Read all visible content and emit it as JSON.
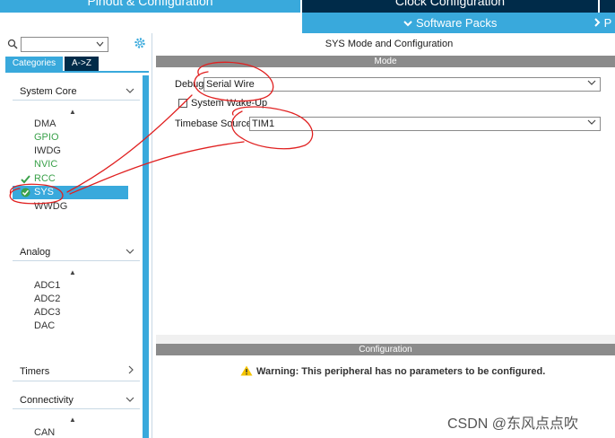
{
  "header": {
    "tabs": [
      {
        "label": "Pinout & Configuration",
        "active": true
      },
      {
        "label": "Clock Configuration",
        "active": false
      }
    ],
    "software_packs_label": "Software Packs",
    "more_label": "P"
  },
  "sidebar": {
    "search": {
      "value": "",
      "placeholder": ""
    },
    "tabs": [
      {
        "label": "Categories",
        "active": true
      },
      {
        "label": "A->Z",
        "active": false
      }
    ],
    "groups": [
      {
        "label": "System Core",
        "expanded": true,
        "items": [
          {
            "label": "DMA",
            "status": "normal"
          },
          {
            "label": "GPIO",
            "status": "configured"
          },
          {
            "label": "IWDG",
            "status": "normal"
          },
          {
            "label": "NVIC",
            "status": "configured"
          },
          {
            "label": "RCC",
            "status": "configured-checked"
          },
          {
            "label": "SYS",
            "status": "selected-checked"
          },
          {
            "label": "WWDG",
            "status": "normal"
          }
        ]
      },
      {
        "label": "Analog",
        "expanded": true,
        "items": [
          {
            "label": "ADC1",
            "status": "normal"
          },
          {
            "label": "ADC2",
            "status": "normal"
          },
          {
            "label": "ADC3",
            "status": "normal"
          },
          {
            "label": "DAC",
            "status": "normal"
          }
        ]
      },
      {
        "label": "Timers",
        "expanded": false,
        "items": []
      },
      {
        "label": "Connectivity",
        "expanded": true,
        "items": [
          {
            "label": "CAN",
            "status": "normal"
          }
        ]
      }
    ]
  },
  "main": {
    "title": "SYS Mode and Configuration",
    "mode_header": "Mode",
    "debug": {
      "label": "Debug",
      "value": "Serial Wire"
    },
    "system_wakeup": {
      "label": "System Wake-Up",
      "checked": false
    },
    "timebase": {
      "label": "Timebase Source",
      "value": "TIM1"
    },
    "config_header": "Configuration",
    "warning": "Warning: This peripheral has no parameters to be configured."
  },
  "watermark": "CSDN @东风点点吹",
  "colors": {
    "accent": "#39a9dc",
    "dark_navy": "#002b49",
    "configured_green": "#3aa14a",
    "section_gray": "#8b8b8b",
    "annotation_red": "#e02020",
    "warning_yellow": "#f5c400"
  }
}
